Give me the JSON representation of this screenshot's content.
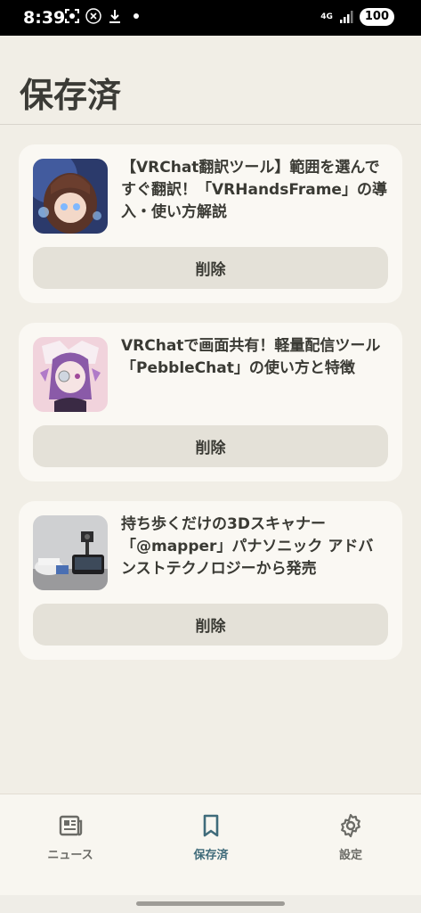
{
  "status_bar": {
    "time": "8:39",
    "network": "4G",
    "battery": "100",
    "left_icons": [
      "screenshot-icon",
      "x-app-icon",
      "download-icon",
      "dot-icon"
    ]
  },
  "page": {
    "title": "保存済"
  },
  "articles": [
    {
      "title": "【VRChat翻訳ツール】範囲を選んですぐ翻訳！「VRHandsFrame」の導入・使い方解説",
      "delete_label": "削除"
    },
    {
      "title": "VRChatで画面共有！軽量配信ツール「PebbleChat」の使い方と特徴",
      "delete_label": "削除"
    },
    {
      "title": "持ち歩くだけの3Dスキャナー「@mapper」パナソニック アドバンストテクノロジーから発売",
      "delete_label": "削除"
    }
  ],
  "bottom_nav": {
    "items": [
      {
        "label": "ニュース",
        "icon": "newspaper-icon",
        "active": false
      },
      {
        "label": "保存済",
        "icon": "bookmark-icon",
        "active": true
      },
      {
        "label": "設定",
        "icon": "gear-icon",
        "active": false
      }
    ],
    "active_color": "#3f6b7a",
    "inactive_color": "#6b6b66"
  },
  "colors": {
    "background": "#f1eee6",
    "card": "#faf8f3",
    "button": "#e4e1d8"
  }
}
